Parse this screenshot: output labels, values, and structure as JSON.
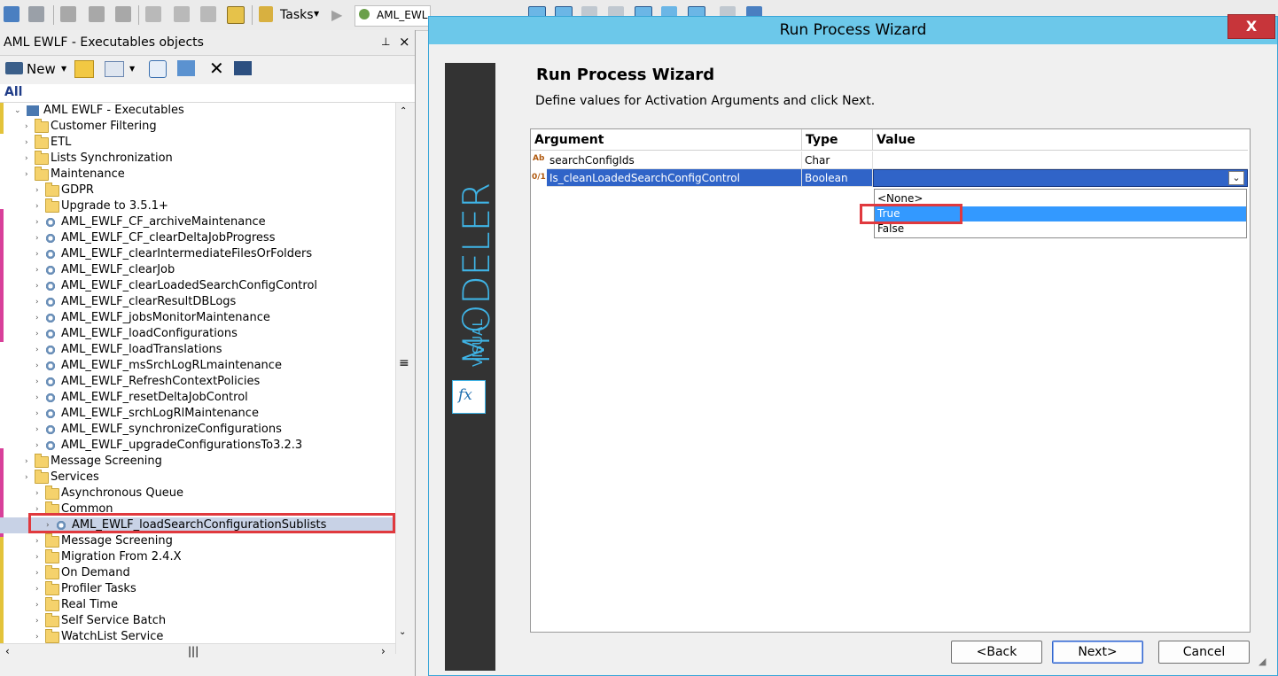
{
  "toolbar": {
    "tasks_label": "Tasks",
    "doc_tab_label": "AML_EWL"
  },
  "left_panel": {
    "title": "AML EWLF - Executables objects",
    "pin_glyph": "⊥",
    "close_glyph": "×",
    "new_label": "New",
    "all_label": "All",
    "tree_root": "AML EWLF - Executables",
    "tree": [
      {
        "label": "Customer Filtering",
        "level": 1,
        "kind": "folder"
      },
      {
        "label": "ETL",
        "level": 1,
        "kind": "folder"
      },
      {
        "label": "Lists Synchronization",
        "level": 1,
        "kind": "folder"
      },
      {
        "label": "Maintenance",
        "level": 1,
        "kind": "folder"
      },
      {
        "label": "GDPR",
        "level": 2,
        "kind": "folder"
      },
      {
        "label": "Upgrade to 3.5.1+",
        "level": 2,
        "kind": "folder"
      },
      {
        "label": "AML_EWLF_CF_archiveMaintenance",
        "level": 2,
        "kind": "process"
      },
      {
        "label": "AML_EWLF_CF_clearDeltaJobProgress",
        "level": 2,
        "kind": "process"
      },
      {
        "label": "AML_EWLF_clearIntermediateFilesOrFolders",
        "level": 2,
        "kind": "process"
      },
      {
        "label": "AML_EWLF_clearJob",
        "level": 2,
        "kind": "process"
      },
      {
        "label": "AML_EWLF_clearLoadedSearchConfigControl",
        "level": 2,
        "kind": "process"
      },
      {
        "label": "AML_EWLF_clearResultDBLogs",
        "level": 2,
        "kind": "process"
      },
      {
        "label": "AML_EWLF_jobsMonitorMaintenance",
        "level": 2,
        "kind": "process"
      },
      {
        "label": "AML_EWLF_loadConfigurations",
        "level": 2,
        "kind": "process"
      },
      {
        "label": "AML_EWLF_loadTranslations",
        "level": 2,
        "kind": "process"
      },
      {
        "label": "AML_EWLF_msSrchLogRLmaintenance",
        "level": 2,
        "kind": "process"
      },
      {
        "label": "AML_EWLF_RefreshContextPolicies",
        "level": 2,
        "kind": "process"
      },
      {
        "label": "AML_EWLF_resetDeltaJobControl",
        "level": 2,
        "kind": "process"
      },
      {
        "label": "AML_EWLF_srchLogRlMaintenance",
        "level": 2,
        "kind": "process"
      },
      {
        "label": "AML_EWLF_synchronizeConfigurations",
        "level": 2,
        "kind": "process"
      },
      {
        "label": "AML_EWLF_upgradeConfigurationsTo3.2.3",
        "level": 2,
        "kind": "process"
      },
      {
        "label": "Message Screening",
        "level": 1,
        "kind": "folder"
      },
      {
        "label": "Services",
        "level": 1,
        "kind": "folder"
      },
      {
        "label": "Asynchronous Queue",
        "level": 2,
        "kind": "folder"
      },
      {
        "label": "Common",
        "level": 2,
        "kind": "folder"
      },
      {
        "label": "AML_EWLF_loadSearchConfigurationSublists",
        "level": 3,
        "kind": "process",
        "selected": true
      },
      {
        "label": "Message Screening",
        "level": 2,
        "kind": "folder"
      },
      {
        "label": "Migration From 2.4.X",
        "level": 2,
        "kind": "folder"
      },
      {
        "label": "On Demand",
        "level": 2,
        "kind": "folder"
      },
      {
        "label": "Profiler Tasks",
        "level": 2,
        "kind": "folder"
      },
      {
        "label": "Real Time",
        "level": 2,
        "kind": "folder"
      },
      {
        "label": "Self Service Batch",
        "level": 2,
        "kind": "folder"
      },
      {
        "label": "WatchList Service",
        "level": 2,
        "kind": "folder"
      }
    ]
  },
  "wizard": {
    "window_title": "Run Process Wizard",
    "close_glyph": "X",
    "sidebar_small": "VISUAL",
    "sidebar_large": "MODELER",
    "fx_glyph": "fx",
    "heading": "Run Process Wizard",
    "instruction": "Define values for Activation Arguments and click Next.",
    "columns": [
      "Argument",
      "Type",
      "Value"
    ],
    "rows": [
      {
        "icon": "Ab",
        "argument": "searchConfigIds",
        "type": "Char",
        "value": ""
      },
      {
        "icon": "0/1",
        "argument": "Is_cleanLoadedSearchConfigControl",
        "type": "Boolean",
        "value": ""
      }
    ],
    "dropdown_options": [
      "<None>",
      "True",
      "False"
    ],
    "highlighted_option": "True",
    "back_label": "<Back",
    "next_label": "Next>",
    "cancel_label": "Cancel"
  },
  "colors": {
    "accent": "#3fb4e6",
    "title_bar": "#6cc8ea",
    "selection": "#3064c8",
    "highlight_red": "#e0393e",
    "sidebar": "#333333"
  }
}
